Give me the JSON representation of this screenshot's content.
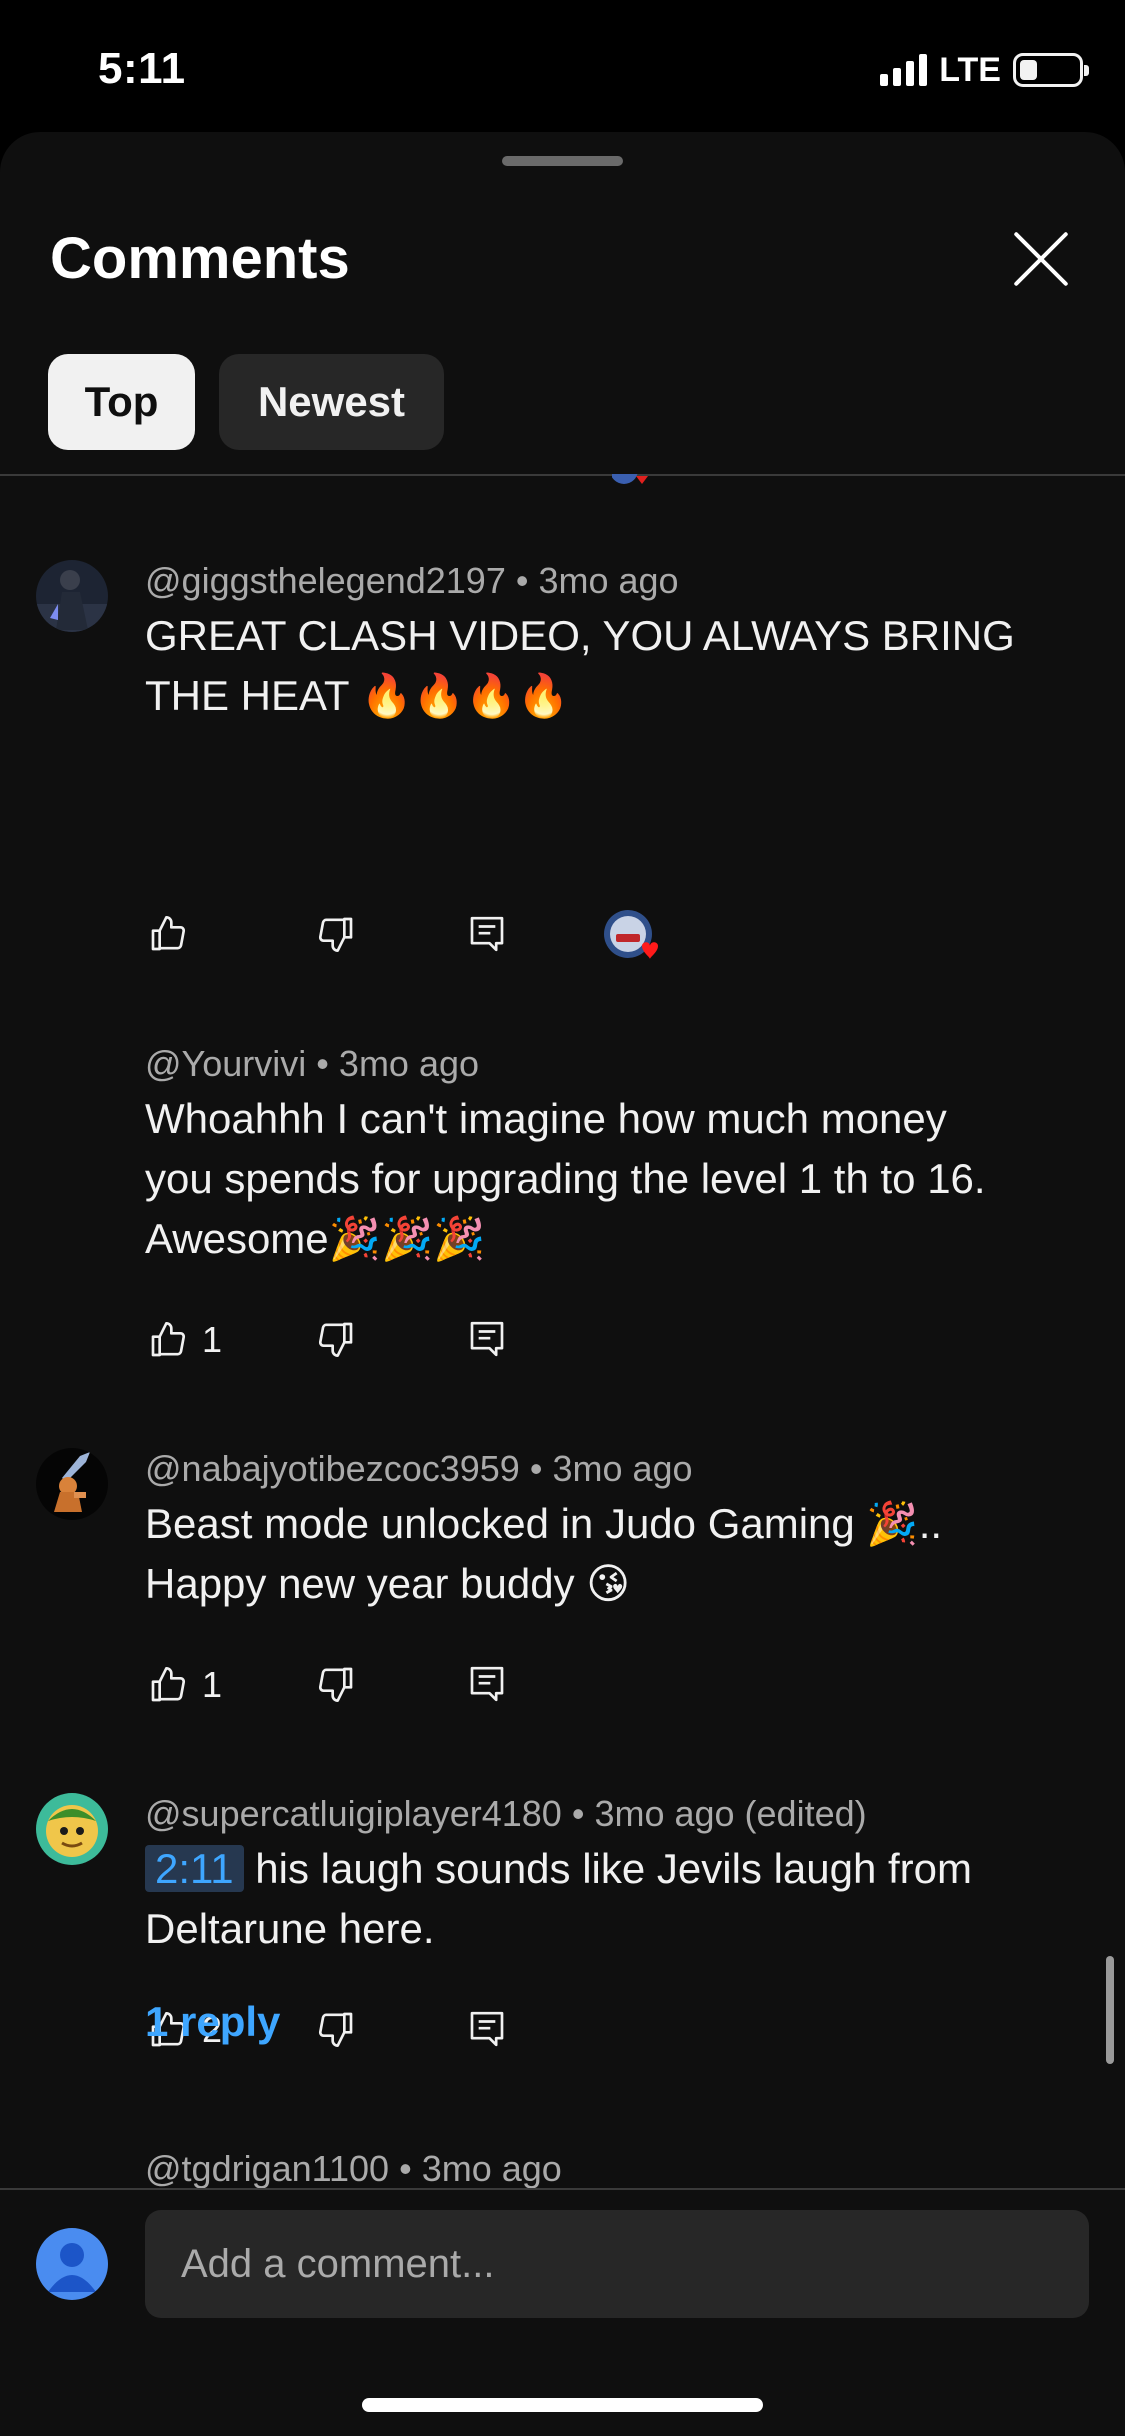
{
  "status_bar": {
    "time": "5:11",
    "network": "LTE",
    "battery_percent": 30
  },
  "sheet": {
    "title": "Comments"
  },
  "tabs": [
    {
      "label": "Top",
      "selected": true
    },
    {
      "label": "Newest",
      "selected": false
    }
  ],
  "comments": [
    {
      "author": "@giggsthelegend2197",
      "time": "3mo ago",
      "text_line1": "GREAT CLASH VIDEO, YOU ALWAYS BRING",
      "text_line2": "THE HEAT 🔥🔥🔥🔥",
      "likes": "",
      "creator_hearted": true
    },
    {
      "author": "@Yourvivi",
      "time": "3mo ago",
      "text_line1": "Whoahhh I can't imagine how much money",
      "text_line2": "you spends for upgrading the level 1 th to 16.",
      "text_line3": "Awesome🎉🎉🎉",
      "likes": "1"
    },
    {
      "author": "@nabajyotibezcoc3959",
      "time": "3mo ago",
      "text_line1": "Beast mode unlocked in Judo Gaming 🎉..",
      "text_line2": "Happy new year buddy 😘",
      "likes": "1"
    },
    {
      "author": "@supercatluigiplayer4180",
      "time": "3mo ago (edited)",
      "timestamp_link": "2:11",
      "text_line1": " his laugh sounds like Jevils laugh from",
      "text_line2": "Deltarune here.",
      "likes": "2",
      "replies_label": "1 reply"
    }
  ],
  "next_comment_peek": {
    "author": "@tgdrigan1100",
    "time": "3mo ago"
  },
  "composer": {
    "placeholder": "Add a comment..."
  },
  "meta_separator": "•",
  "colors": {
    "background": "#0f0f0f",
    "link_blue": "#3ea6ff",
    "secondary_text": "#aaaaaa",
    "chip_dark": "#272727"
  }
}
